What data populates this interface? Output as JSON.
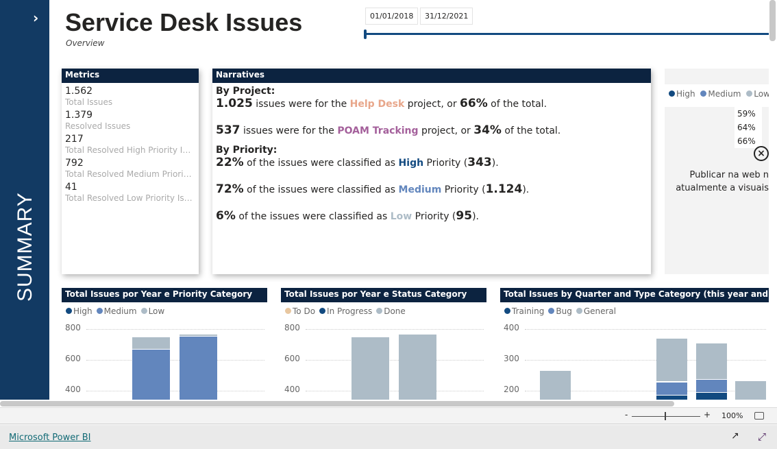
{
  "sidebar": {
    "label": "SUMMARY"
  },
  "header": {
    "title": "Service Desk Issues",
    "subtitle": "Overview"
  },
  "date_slider": {
    "start": "01/01/2018",
    "end": "31/12/2021",
    "fill_fraction": 1.0
  },
  "metrics": {
    "title": "Metrics",
    "items": [
      {
        "value": "1.562",
        "label": "Total Issues"
      },
      {
        "value": "1.379",
        "label": "Resolved Issues"
      },
      {
        "value": "217",
        "label": "Total Resolved High Priority Issues"
      },
      {
        "value": "792",
        "label": "Total Resolved Medium Priority Issues"
      },
      {
        "value": "41",
        "label": "Total Resolved Low Priority Issues"
      }
    ]
  },
  "narratives": {
    "title": "Narratives",
    "by_project": "By Project:",
    "by_priority": "By Priority:",
    "p1": {
      "num": "1.025",
      "t1": " issues were for the ",
      "proj": "Help Desk",
      "t2": " project, or ",
      "pct": "66%",
      "t3": " of the total."
    },
    "p2": {
      "num": "537",
      "t1": " issues were for the ",
      "proj": "POAM Tracking",
      "t2": " project, or ",
      "pct": "34%",
      "t3": " of the total."
    },
    "q1": {
      "pct": "22%",
      "t1": " of the issues were classified as ",
      "pri": "High",
      "t2": " Priority (",
      "n": "343",
      "t3": ")."
    },
    "q2": {
      "pct": "72%",
      "t1": " of the issues were classified as ",
      "pri": "Medium",
      "t2": " Priority (",
      "n": "1.124",
      "t3": ")."
    },
    "q3": {
      "pct": "6%",
      "t1": " of the issues were classified as ",
      "pri": "Low",
      "t2": " Priority (",
      "n": "95",
      "t3": ")."
    }
  },
  "right_panel": {
    "legend": [
      "High",
      "Medium",
      "Low"
    ],
    "percents": [
      "59%",
      "64%",
      "66%"
    ],
    "error_line1": "Publicar na web n",
    "error_line2": "atualmente a visuais"
  },
  "colors": {
    "high": "#124a80",
    "medium": "#6286bd",
    "low": "#adbcc7",
    "todo": "#e8c7a0",
    "helpdesk": "#e8a68a",
    "poam": "#a4609b",
    "navy": "#0c2340"
  },
  "chart_data": [
    {
      "type": "bar",
      "stacked": true,
      "title": "Total Issues por Year e Priority Category",
      "legend": [
        "High",
        "Medium",
        "Low"
      ],
      "yticks": [
        800,
        600,
        400
      ],
      "series": [
        {
          "name": "Medium",
          "values": [
            670,
            755
          ]
        },
        {
          "name": "Low",
          "values": [
            80,
            15
          ]
        }
      ]
    },
    {
      "type": "bar",
      "stacked": true,
      "title": "Total Issues por Year e Status Category",
      "legend": [
        "To Do",
        "In Progress",
        "Done"
      ],
      "yticks": [
        800,
        600,
        400
      ],
      "series": [
        {
          "name": "Done",
          "values": [
            750,
            770
          ]
        }
      ]
    },
    {
      "type": "bar",
      "stacked": true,
      "title": "Total Issues by Quarter and Type Category (this year and last year)",
      "legend": [
        "Training",
        "Bug",
        "General"
      ],
      "yticks": [
        400,
        300,
        200
      ],
      "series": [
        {
          "name": "Training",
          "values": [
            0,
            186,
            195,
            0
          ]
        },
        {
          "name": "Bug",
          "values": [
            0,
            44,
            42,
            0
          ]
        },
        {
          "name": "General",
          "values": [
            267,
            142,
            118,
            234
          ]
        }
      ]
    }
  ],
  "zoom": {
    "minus": "-",
    "plus": "+",
    "level": "100%"
  },
  "footer": {
    "link": "Microsoft Power BI"
  }
}
